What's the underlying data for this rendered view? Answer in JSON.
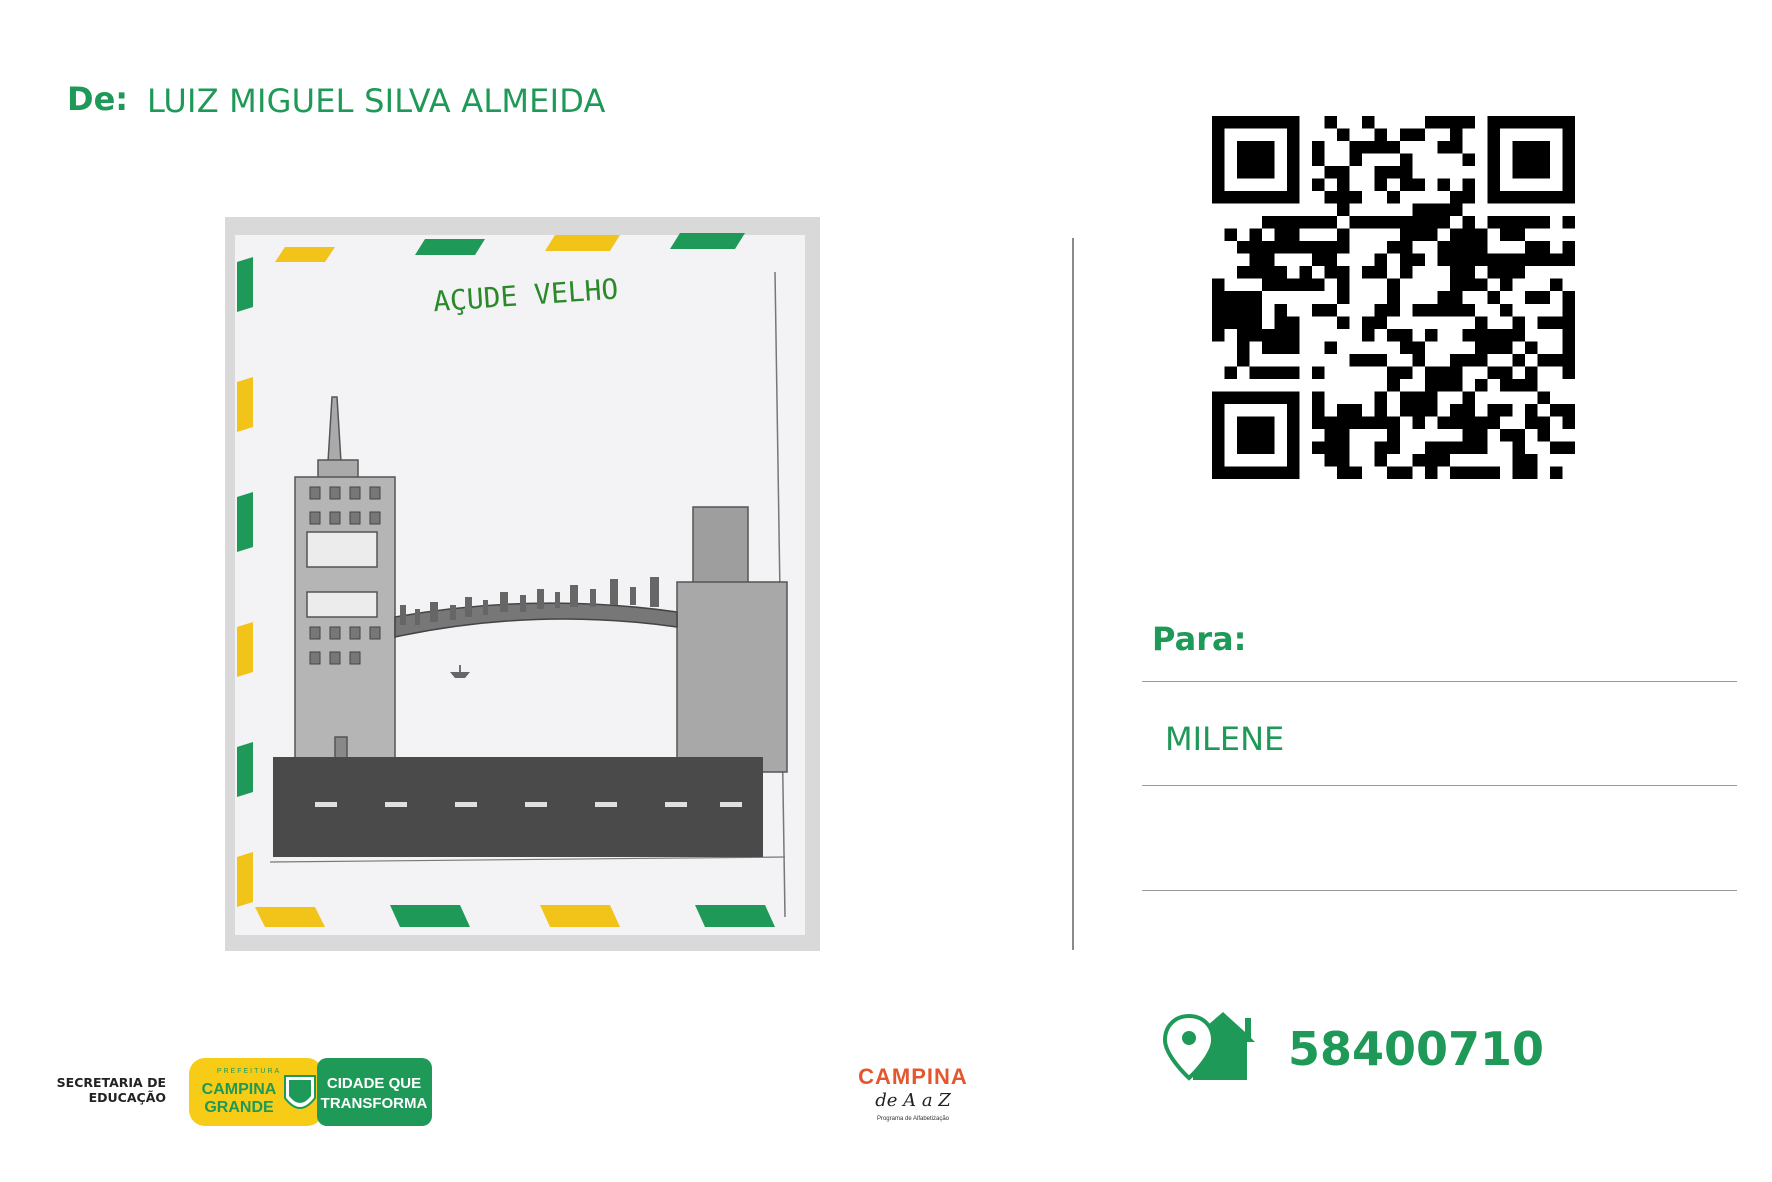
{
  "from": {
    "label": "De:",
    "name": "LUIZ MIGUEL SILVA ALMEIDA"
  },
  "drawing": {
    "title": "AÇUDE VELHO"
  },
  "to": {
    "label": "Para:",
    "name": "MILENE"
  },
  "cep": {
    "icon": "house-location-icon",
    "value": "58400710"
  },
  "footer": {
    "secretaria": "SECRETARIA DE EDUCAÇÃO",
    "prefeitura_top": "PREFEITURA",
    "prefeitura_city1": "CAMPINA",
    "prefeitura_city2": "GRANDE",
    "slogan1": "CIDADE QUE",
    "slogan2": "TRANSFORMA",
    "program_title": "CAMPINA",
    "program_sub": "de A a Z",
    "program_caption": "Programa de Alfabetização"
  },
  "colors": {
    "brand_green": "#1f9957",
    "brand_yellow": "#f2c318"
  }
}
